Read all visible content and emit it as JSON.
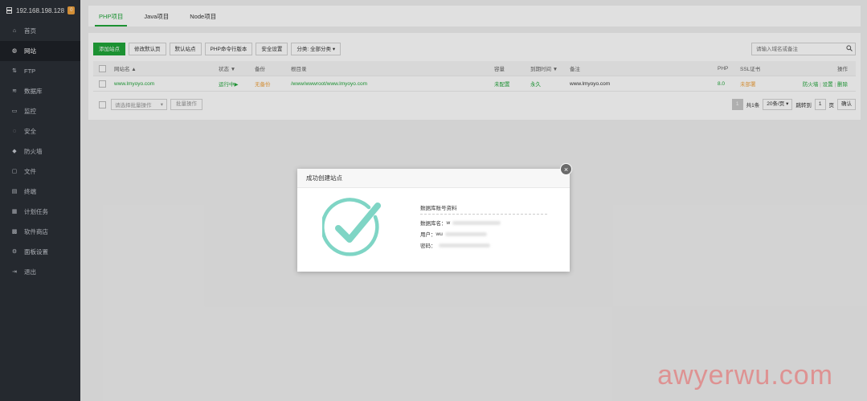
{
  "sidebar": {
    "host": "192.168.198.128",
    "badge": "0",
    "items": [
      {
        "label": "首页",
        "icon": "home-icon"
      },
      {
        "label": "网站",
        "icon": "globe-icon",
        "active": true
      },
      {
        "label": "FTP",
        "icon": "ftp-icon"
      },
      {
        "label": "数据库",
        "icon": "database-icon"
      },
      {
        "label": "监控",
        "icon": "monitor-icon"
      },
      {
        "label": "安全",
        "icon": "shield-icon"
      },
      {
        "label": "防火墙",
        "icon": "firewall-icon"
      },
      {
        "label": "文件",
        "icon": "folder-icon"
      },
      {
        "label": "终端",
        "icon": "terminal-icon"
      },
      {
        "label": "计划任务",
        "icon": "calendar-icon"
      },
      {
        "label": "软件商店",
        "icon": "apps-icon"
      },
      {
        "label": "面板设置",
        "icon": "gear-icon"
      },
      {
        "label": "退出",
        "icon": "logout-icon"
      }
    ]
  },
  "tabs": [
    "PHP项目",
    "Java项目",
    "Node项目"
  ],
  "toolbar": {
    "add_site": "添加站点",
    "default_page": "修改默认页",
    "default_site": "默认站点",
    "php_cli": "PHP命令行版本",
    "security": "安全设置",
    "category": "分类: 全部分类"
  },
  "search": {
    "placeholder": "请输入域名或备注"
  },
  "table": {
    "headers": {
      "name": "网站名 ▲",
      "status": "状态 ▼",
      "backup": "备份",
      "root": "根目录",
      "capacity": "容量",
      "expire": "到期时间 ▼",
      "remark": "备注",
      "php": "PHP",
      "ssl": "SSL证书",
      "ops": "操作"
    },
    "rows": [
      {
        "name": "www.lmyoyo.com",
        "status": "运行中▶",
        "backup": "无备份",
        "root": "/www/wwwroot/www.lmyoyo.com",
        "capacity": "未配置",
        "expire": "永久",
        "remark": "www.lmyoyo.com",
        "php": "8.0",
        "ssl": "未部署",
        "op_firewall": "防火墙",
        "op_settings": "设置",
        "op_delete": "删除"
      }
    ]
  },
  "footer": {
    "batch_select": "请选择批量操作",
    "batch_button": "批量操作",
    "current_page": "1",
    "total": "共1条",
    "per_page": "20条/页",
    "jump_label": "跳转到",
    "jump_value": "1",
    "page_unit": "页",
    "confirm": "确认"
  },
  "modal": {
    "title": "成功创建站点",
    "info_title": "数据库账号资料",
    "db_name_label": "数据库名：",
    "db_name_value": "w",
    "user_label": "用户：",
    "user_value": "wu",
    "password_label": "密码："
  },
  "watermark": "awyerwu.com",
  "colors": {
    "accent": "#20a53a",
    "warning": "#f0a23e",
    "sidebar": "#2b2f36",
    "check": "#7fd5c5"
  }
}
